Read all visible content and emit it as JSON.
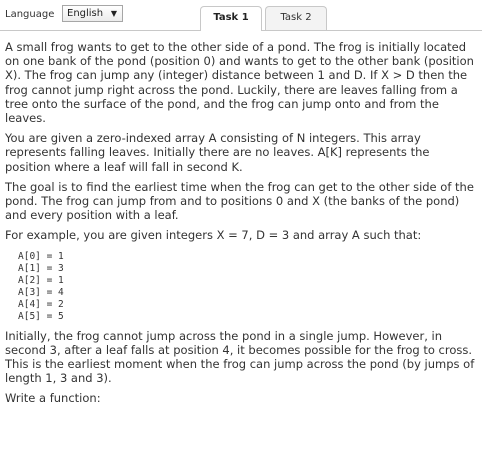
{
  "toolbar": {
    "language_label": "Language",
    "language_value": "English",
    "tabs": [
      {
        "label": "Task 1",
        "active": true
      },
      {
        "label": "Task 2",
        "active": false
      }
    ]
  },
  "task": {
    "paragraphs": [
      "A small frog wants to get to the other side of a pond. The frog is initially located on one bank of the pond (position 0) and wants to get to the other bank (position X). The frog can jump any (integer) distance between 1 and D. If X > D then the frog cannot jump right across the pond. Luckily, there are leaves falling from a tree onto the surface of the pond, and the frog can jump onto and from the leaves.",
      "You are given a zero-indexed array A consisting of N integers. This array represents falling leaves. Initially there are no leaves. A[K] represents the position where a leaf will fall in second K.",
      "The goal is to find the earliest time when the frog can get to the other side of the pond. The frog can jump from and to positions 0 and X (the banks of the pond) and every position with a leaf.",
      "For example, you are given integers X = 7, D = 3 and array A such that:"
    ],
    "code_lines": [
      "A[0] = 1",
      "A[1] = 3",
      "A[2] = 1",
      "A[3] = 4",
      "A[4] = 2",
      "A[5] = 5"
    ],
    "after_paragraphs": [
      "Initially, the frog cannot jump across the pond in a single jump. However, in second 3, after a leaf falls at position 4, it becomes possible for the frog to cross. This is the earliest moment when the frog can jump across the pond (by jumps of length 1, 3 and 3).",
      "Write a function:"
    ]
  }
}
